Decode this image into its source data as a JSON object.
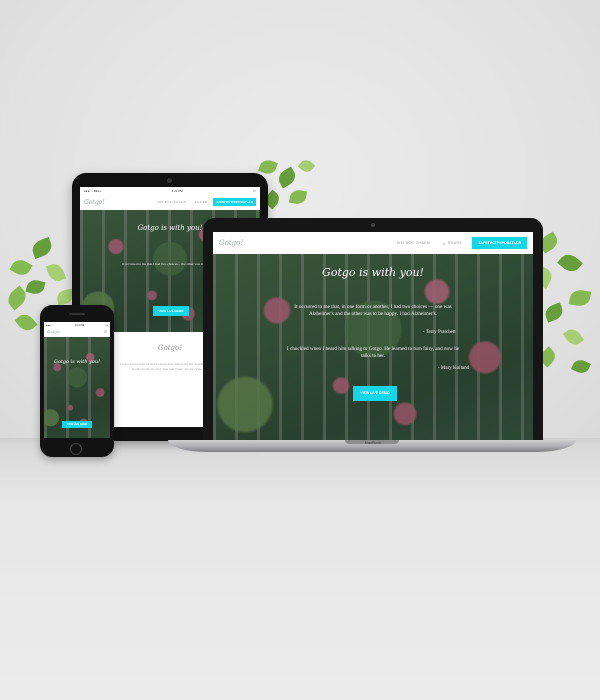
{
  "laptop": {
    "nav": {
      "link": "МЫ ВСЕ ЗНАЕМ",
      "share": "SHARE",
      "cta": "ЗАРЕГИСТРИРОВАТЬСЯ"
    },
    "hero_title": "Gotgo is with you!",
    "quote1": "It occurred to me that, in one form or another, I had two choices — one was Alzheimer's and the other was to be happy. I had Alzheimer's.",
    "author1": "- Terry Pratchett",
    "quote2": "I chuckled when I heard him talking to Gotgo. He learned to turn fairy, and now he talks to her.",
    "author2": "- Mary Kolland",
    "button": "VIEW LIVE DEMO",
    "brand": "MacBook"
  },
  "tablet": {
    "status_left": "●●●○○ BELL",
    "status_time": "4:21 PM",
    "nav": {
      "link": "МЫ ВСЕ ЗНАЕМ",
      "share": "SHARE",
      "cta": "ЗАРЕГИСТРИРОВАТЬСЯ"
    },
    "hero_title": "Gotgo is with you!",
    "hero_text": "It occurred to me that I had two choices... the other was to be happy.",
    "button": "VIEW LIVE DEMO",
    "section_title": "Gotgo!",
    "section_text": "Lorem ipsum dolor sit amet, consectetur adipiscing elit. Vestibulum ac arcu et odio hendrerit porta vitae quis lorem. Aenean vitae nisi."
  },
  "phone": {
    "status_left": "●●●○○",
    "status_time": "4:21 PM",
    "hero_title": "Gotgo is with you!",
    "button": "VIEW LIVE DEMO"
  }
}
